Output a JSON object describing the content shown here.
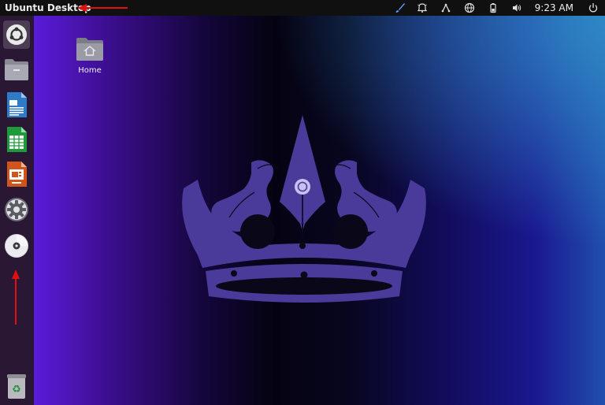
{
  "topbar": {
    "app_title": "Ubuntu Desktop",
    "clock": "9:23 AM",
    "tray_icons": [
      "brush-icon",
      "notification-bell-icon",
      "network-icon",
      "globe-icon",
      "battery-icon",
      "volume-icon",
      "power-icon"
    ]
  },
  "dock": {
    "items": [
      "ubuntu-logo",
      "files",
      "libreoffice-writer",
      "libreoffice-calc",
      "libreoffice-impress",
      "settings",
      "optical-disc"
    ],
    "trash": "trash"
  },
  "desktop": {
    "icons": [
      {
        "label": "Home"
      }
    ]
  },
  "colors": {
    "annotation_arrow": "#e01010",
    "dock_bg": "#2a1734",
    "topbar_bg": "#101010",
    "crown": "#4a3a9a"
  }
}
